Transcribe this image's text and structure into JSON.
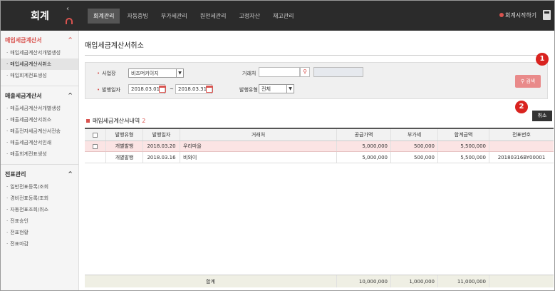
{
  "app": {
    "logo": "회계"
  },
  "nav": {
    "items": [
      "회계관리",
      "자동증빙",
      "부가세관리",
      "원천세관리",
      "고정자산",
      "재고관리"
    ],
    "start_link": "회계시작하기"
  },
  "sidebar": {
    "sections": [
      {
        "title": "매입세금계산서",
        "items": [
          "매입세금계산서개별생성",
          "매입세금계산서취소",
          "매입회계전표생성"
        ]
      },
      {
        "title": "매출세금계산서",
        "items": [
          "매출세금계산서개별생성",
          "매출세금계산서취소",
          "매출전자세금계산서전송",
          "매출세금계산서인쇄",
          "매출회계전표생성"
        ]
      },
      {
        "title": "전표관리",
        "items": [
          "일반전표등록/조회",
          "경비전표등록/조회",
          "자동전표조회/취소",
          "전표승인",
          "전표현황",
          "전표마감"
        ]
      }
    ]
  },
  "page": {
    "title": "매입세금계산서취소"
  },
  "search": {
    "business_label": "사업장",
    "business_value": "비즈머키이지",
    "vendor_label": "거래처",
    "vendor_value": "",
    "date_label": "발행일자",
    "date_from": "2018.03.01",
    "date_to": "2018.03.31",
    "date_sep": "~",
    "issue_type_label": "발행유형",
    "issue_type_value": "전체",
    "search_button": "검색"
  },
  "badges": {
    "one": "1",
    "two": "2"
  },
  "list": {
    "title": "매입세금계산서내역",
    "count": "2",
    "cancel_button": "취소",
    "columns": [
      "발행유형",
      "발행일자",
      "거래처",
      "공급가액",
      "부가세",
      "합계금액",
      "전표번호"
    ],
    "rows": [
      [
        "개별발행",
        "2018.03.20",
        "우리마을",
        "5,000,000",
        "500,000",
        "5,500,000",
        ""
      ],
      [
        "개별발행",
        "2018.03.16",
        "비와이",
        "5,000,000",
        "500,000",
        "5,500,000",
        "20180316BY00001"
      ]
    ],
    "footer": {
      "label": "합계",
      "supply": "10,000,000",
      "vat": "1,000,000",
      "total": "11,000,000"
    }
  },
  "colors": {
    "accent": "#d9534f",
    "topbar": "#2b2b2b",
    "badge": "#d9231f"
  }
}
